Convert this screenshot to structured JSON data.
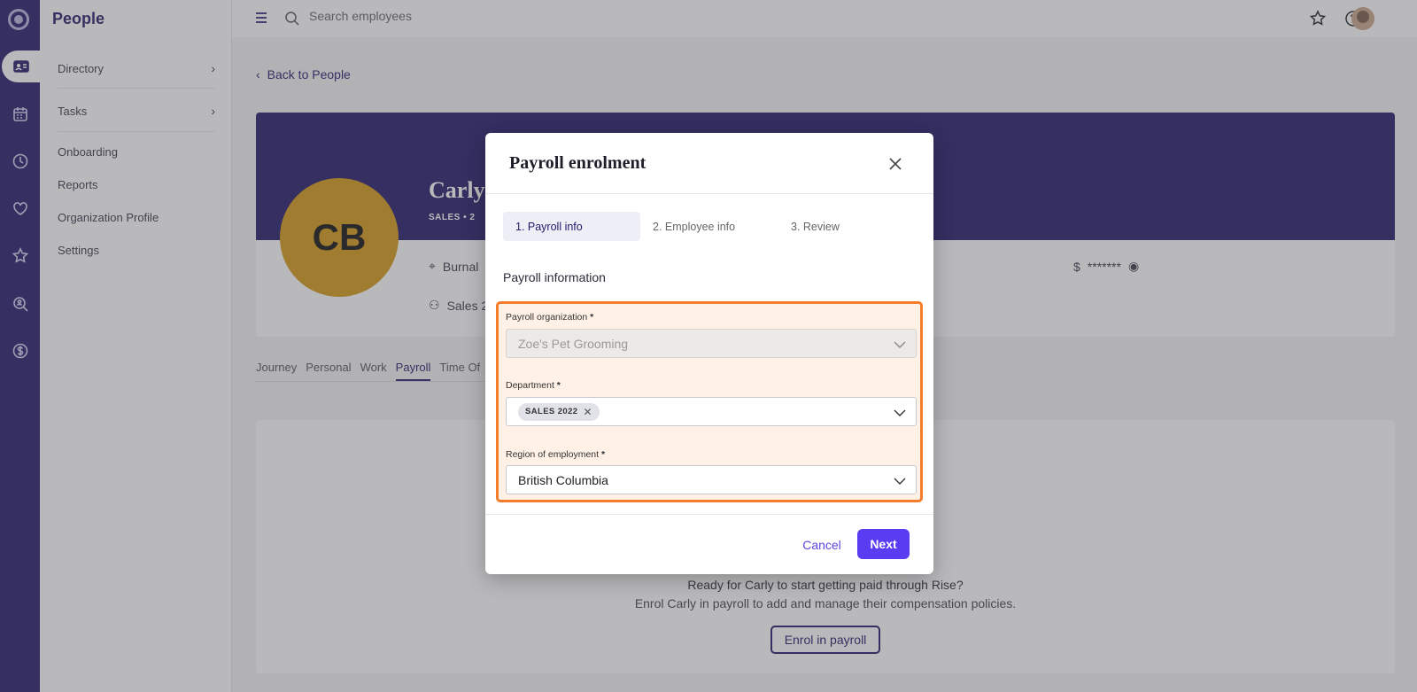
{
  "app": {
    "title": "People"
  },
  "rail": {
    "icons": [
      "logo-icon",
      "id-card-icon",
      "calendar-icon",
      "clock-icon",
      "heart-hand-icon",
      "star-badge-icon",
      "search-person-icon",
      "dollar-icon"
    ],
    "active": "id-card-icon"
  },
  "sidebar": {
    "items": [
      {
        "label": "Directory",
        "has_chevron": true
      },
      {
        "label": "Tasks",
        "has_chevron": true
      },
      {
        "label": "Onboarding"
      },
      {
        "label": "Reports"
      },
      {
        "label": "Organization Profile"
      },
      {
        "label": "Settings"
      }
    ]
  },
  "topbar": {
    "search_placeholder": "Search employees",
    "icons": [
      "menu-icon",
      "search-icon",
      "star-icon",
      "help-icon",
      "user-avatar"
    ]
  },
  "page": {
    "back_label": "Back to People",
    "profile": {
      "initials": "CB",
      "name": "Carly",
      "meta": "SALES  •  2",
      "location": "Burnal",
      "team": "Sales 2",
      "masked_value": "*******"
    },
    "tabs": [
      "Journey",
      "Personal",
      "Work",
      "Payroll",
      "Time Of"
    ],
    "active_tab": "Payroll",
    "empty_state": {
      "title": "Ready for Carly to start getting paid through Rise?",
      "subtitle": "Enrol Carly in payroll to add and manage their compensation policies.",
      "button": "Enrol in payroll"
    }
  },
  "modal": {
    "title": "Payroll enrolment",
    "steps": [
      "1. Payroll info",
      "2. Employee info",
      "3. Review"
    ],
    "active_step": 1,
    "section_title": "Payroll information",
    "fields": {
      "payroll_org": {
        "label": "Payroll organization",
        "required": "*",
        "value": "Zoe's Pet Grooming",
        "disabled": true
      },
      "department": {
        "label": "Department",
        "required": "*",
        "chip": "SALES 2022"
      },
      "region": {
        "label": "Region of employment",
        "required": "*",
        "value": "British Columbia"
      }
    },
    "cancel_label": "Cancel",
    "next_label": "Next"
  },
  "colors": {
    "brand": "#231a6b",
    "primary_button": "#5a3df2",
    "highlight_border": "#f47c2a",
    "highlight_fill": "#fff1e6",
    "avatar_bg": "#d49a18"
  }
}
